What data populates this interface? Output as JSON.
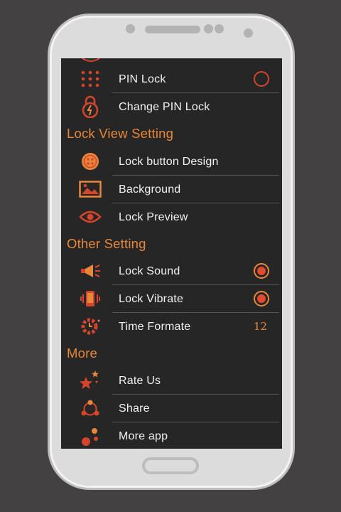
{
  "settings": {
    "pin_lock": {
      "label": "PIN Lock",
      "enabled": false
    },
    "change_pin_lock": {
      "label": "Change PIN Lock"
    },
    "lock_view_section": "Lock View Setting",
    "lock_button_design": {
      "label": "Lock button Design"
    },
    "background": {
      "label": "Background"
    },
    "lock_preview": {
      "label": "Lock Preview"
    },
    "other_section": "Other Setting",
    "lock_sound": {
      "label": "Lock Sound",
      "enabled": true
    },
    "lock_vibrate": {
      "label": "Lock Vibrate",
      "enabled": true
    },
    "time_formate": {
      "label": "Time Formate",
      "value": "12"
    },
    "more_section": "More",
    "rate_us": {
      "label": "Rate Us"
    },
    "share": {
      "label": "Share"
    },
    "more_app": {
      "label": "More app"
    }
  },
  "colors": {
    "accent": "#e8873a",
    "icon_red": "#d5452c",
    "background": "#262626"
  },
  "icons": [
    "pin-grid-icon",
    "lock-icon",
    "button-icon",
    "image-icon",
    "eye-icon",
    "megaphone-icon",
    "vibrate-icon",
    "gear-clock-icon",
    "stars-icon",
    "share-icon",
    "dots-icon"
  ]
}
